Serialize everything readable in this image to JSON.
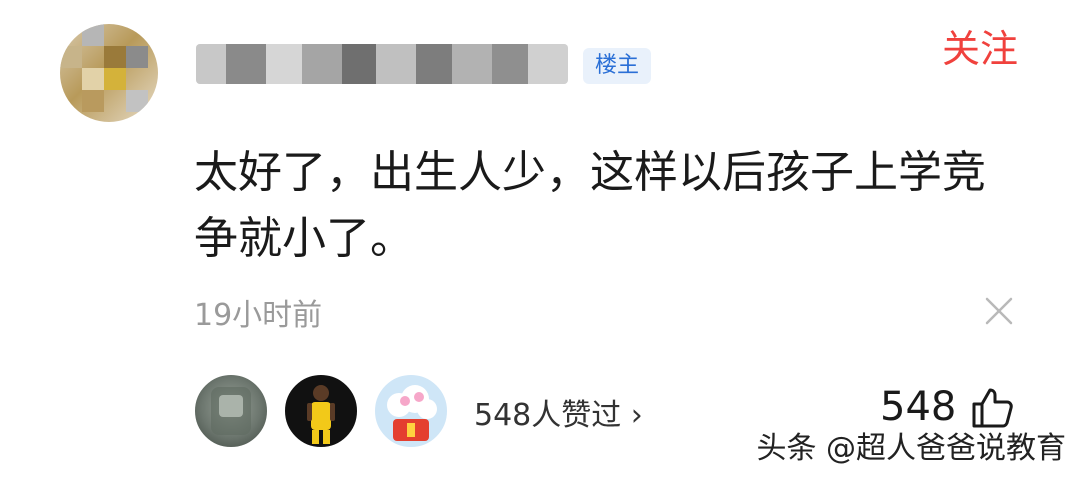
{
  "comment": {
    "owner_badge": "楼主",
    "follow_label": "关注",
    "text": "太好了，出生人少，这样以后孩子上学竞争就小了。",
    "time": "19小时前"
  },
  "likes": {
    "liker_summary": "548人赞过 ›",
    "count": "548"
  },
  "watermark": "头条 @超人爸爸说教育",
  "colors": {
    "follow": "#f0413d",
    "badge_text": "#2a6fd6",
    "badge_bg": "#e9f1fb",
    "meta_gray": "#9a9a9a"
  },
  "icons": [
    "close-icon",
    "thumbs-up-icon",
    "chevron-right-icon"
  ]
}
